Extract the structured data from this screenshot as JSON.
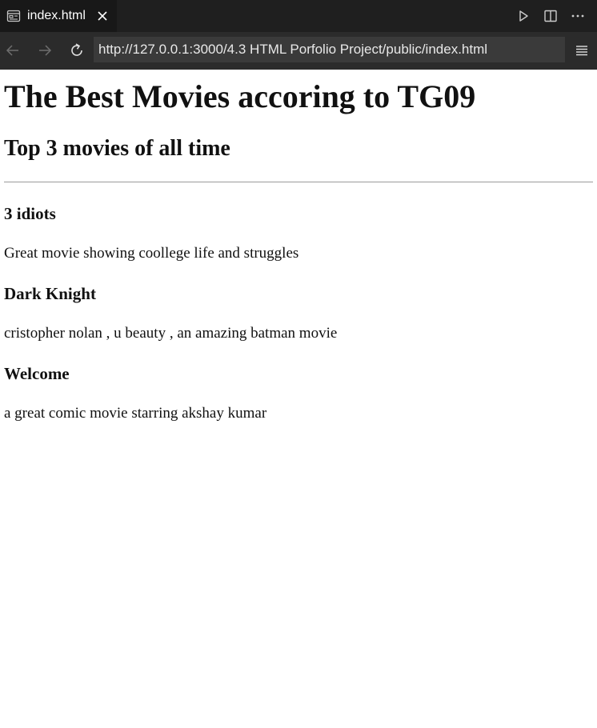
{
  "tab": {
    "title": "index.html"
  },
  "address_bar": {
    "url": "http://127.0.0.1:3000/4.3 HTML Porfolio Project/public/index.html"
  },
  "icons": {
    "tab_file": "preview-icon",
    "tab_close": "close-icon",
    "run": "play-icon",
    "split": "split-editor-icon",
    "more": "more-icon",
    "back": "back-arrow-icon",
    "forward": "forward-arrow-icon",
    "reload": "reload-icon",
    "menu": "menu-icon"
  },
  "colors": {
    "tabbar_bg": "#1f1f1f",
    "tab_active_bg": "#181818",
    "navbar_bg": "#2b2b2b",
    "urlbar_bg": "#3a3a3a",
    "page_bg": "#ffffff"
  },
  "page": {
    "title": "The Best Movies accoring to TG09",
    "subtitle": "Top 3 movies of all time",
    "movies": [
      {
        "name": "3 idiots",
        "description": "Great movie showing coollege life and struggles"
      },
      {
        "name": "Dark Knight",
        "description": "cristopher nolan , u beauty , an amazing batman movie"
      },
      {
        "name": "Welcome",
        "description": "a great comic movie starring akshay kumar"
      }
    ]
  }
}
